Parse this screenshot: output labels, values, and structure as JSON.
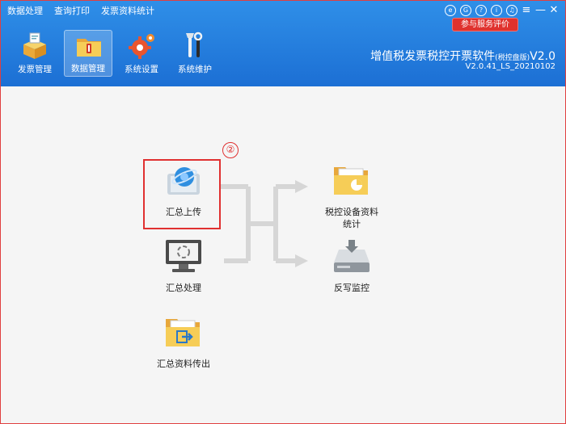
{
  "menu": [
    "数据处理",
    "查询打印",
    "发票资料统计"
  ],
  "window_controls": [
    "e",
    "G",
    "?",
    "i",
    "♫",
    "≡",
    "—",
    "✕"
  ],
  "rate_button": "参与服务评价",
  "app": {
    "title_main": "增值税发票税控开票软件",
    "title_edition": "(税控盘版)",
    "title_suffix": "V2.0",
    "version": "V2.0.41_LS_20210102"
  },
  "toolbar": [
    {
      "label": "发票管理",
      "icon": "invoice-box-icon",
      "active": false
    },
    {
      "label": "数据管理",
      "icon": "data-folder-icon",
      "active": true
    },
    {
      "label": "系统设置",
      "icon": "gear-icon",
      "active": false
    },
    {
      "label": "系统维护",
      "icon": "tools-icon",
      "active": false
    }
  ],
  "nodes": {
    "upload": "汇总上传",
    "process": "汇总处理",
    "export": "汇总资料传出",
    "stats_line1": "税控设备资料",
    "stats_line2": "统计",
    "monitor": "反写监控"
  },
  "step_marker": "②",
  "colors": {
    "titlebar": "#1c6fd4",
    "highlight": "#e03030",
    "folder": "#f2c14e",
    "arrow": "#d6d6d6"
  }
}
